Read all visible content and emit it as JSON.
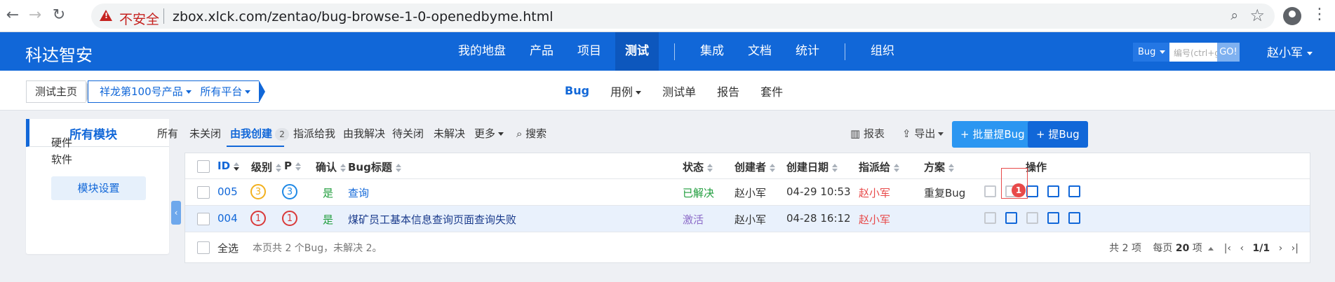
{
  "browser": {
    "back_icon": "←",
    "forward_icon": "→",
    "reload_icon": "↻",
    "insecure_label": "不安全",
    "url": "zbox.xlck.com/zentao/bug-browse-1-0-openedbyme.html"
  },
  "app": {
    "brand": "科达智安",
    "nav": [
      "我的地盘",
      "产品",
      "项目",
      "测试",
      "集成",
      "文档",
      "统计",
      "组织"
    ],
    "active_nav": "测试",
    "search_type": "Bug",
    "search_placeholder": "编号(ctrl+g)",
    "search_go": "GO!",
    "user": "赵小军"
  },
  "subbar": {
    "home": "测试主页",
    "product": "祥龙第100号产品",
    "platform": "所有平台",
    "tabs": [
      "Bug",
      "用例",
      "测试单",
      "报告",
      "套件"
    ],
    "active_tab": "Bug"
  },
  "sidebar": {
    "title": "所有模块",
    "modules": [
      "硬件",
      "软件"
    ],
    "settings_button": "模块设置"
  },
  "filters": {
    "items": [
      "所有",
      "未关闭",
      "由我创建",
      "指派给我",
      "由我解决",
      "待关闭",
      "未解决",
      "更多",
      "搜索"
    ],
    "active": "由我创建",
    "active_count": "2",
    "report": "报表",
    "export": "导出",
    "batch_create": "+ 批量提Bug",
    "create": "+ 提Bug"
  },
  "table": {
    "columns": [
      "ID",
      "级别",
      "P",
      "确认",
      "Bug标题",
      "状态",
      "创建者",
      "创建日期",
      "指派给",
      "方案",
      "操作"
    ],
    "rows": [
      {
        "id": "005",
        "severity": "3",
        "pri": "3",
        "confirmed": "是",
        "title": "查询",
        "status": "已解决",
        "creator": "赵小军",
        "date": "04-29 10:53",
        "assigned": "赵小军",
        "resolution": "重复Bug"
      },
      {
        "id": "004",
        "severity": "1",
        "pri": "1",
        "confirmed": "是",
        "title": "煤矿员工基本信息查询页面查询失败",
        "status": "激活",
        "creator": "赵小军",
        "date": "04-28 16:12",
        "assigned": "赵小军",
        "resolution": ""
      }
    ],
    "footer_select_all": "全选",
    "summary": "本页共 2 个Bug，未解决 2。",
    "total": "共 2 项",
    "per_page_label": "每页",
    "per_page": "20",
    "per_page_unit": "项",
    "page": "1/1"
  },
  "annotation": {
    "marker": "1"
  },
  "colors": {
    "primary": "#1167d8",
    "topbar": "#1167d8",
    "danger": "#e84a4a",
    "success": "#1f9d3c",
    "active_status": "#8c6bc8"
  }
}
